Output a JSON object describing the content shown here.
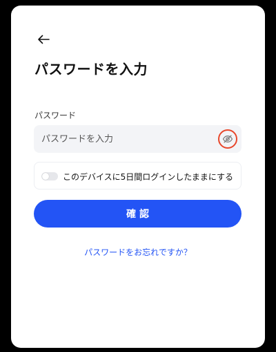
{
  "header": {
    "back_icon": "arrow-left-icon",
    "title": "パスワードを入力"
  },
  "password": {
    "label": "パスワード",
    "placeholder": "パスワードを入力",
    "value": "",
    "visibility_icon": "eye-off-icon"
  },
  "remember": {
    "toggle_on": false,
    "label": "このデバイスに5日間ログインしたままにする"
  },
  "actions": {
    "confirm_label": "確認",
    "forgot_label": "パスワードをお忘れですか？"
  },
  "colors": {
    "accent": "#2354f5",
    "highlight": "#e8472b",
    "field_bg": "#f3f4f7"
  }
}
